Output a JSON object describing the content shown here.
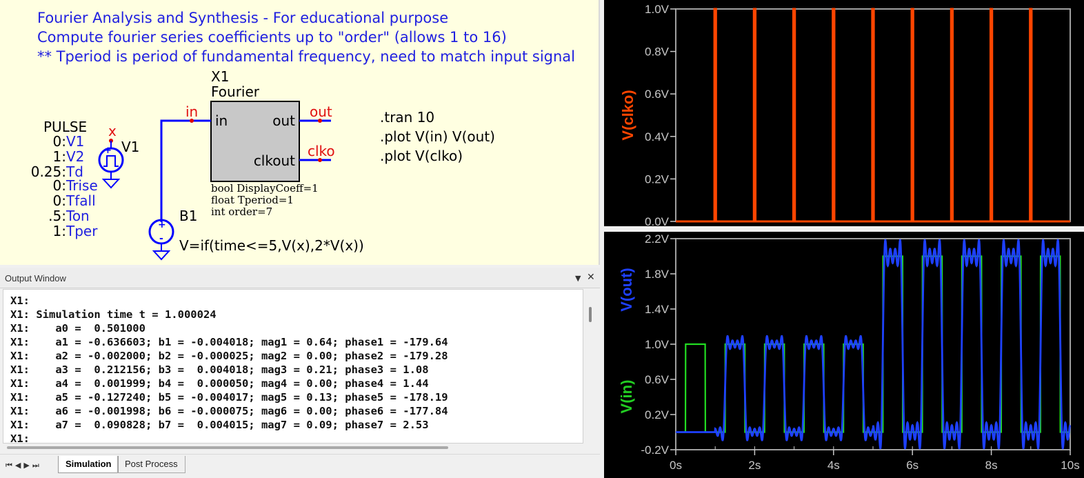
{
  "schematic": {
    "comments": [
      "Fourier Analysis and Synthesis - For educational purpose",
      "Compute fourier series coefficients up to \"order\" (allows 1 to 16)",
      "** Tperiod is period of fundamental frequency, need to match input signal"
    ],
    "x1": {
      "name": "X1",
      "type": "Fourier",
      "pin_in": "in",
      "pin_out": "out",
      "pin_clkout": "clkout",
      "params": [
        "bool DisplayCoeff=1",
        "float Tperiod=1",
        "int order=7"
      ]
    },
    "nets": {
      "in": "in",
      "out": "out",
      "clko": "clko",
      "x": "x"
    },
    "v1": {
      "name": "V1",
      "func": "PULSE",
      "params": [
        {
          "v": "0:",
          "k": "V1"
        },
        {
          "v": "1:",
          "k": "V2"
        },
        {
          "v": "0.25:",
          "k": "Td"
        },
        {
          "v": "0:",
          "k": "Trise"
        },
        {
          "v": "0:",
          "k": "Tfall"
        },
        {
          "v": ".5:",
          "k": "Ton"
        },
        {
          "v": "1:",
          "k": "Tper"
        }
      ]
    },
    "b1": {
      "name": "B1",
      "expr": "V=if(time<=5,V(x),2*V(x))"
    },
    "directives": [
      ".tran 10",
      ".plot V(in) V(out)",
      ".plot V(clko)"
    ]
  },
  "output_window": {
    "title": "Output Window",
    "lines": [
      "X1:",
      "X1: Simulation time t = 1.000024",
      "X1:    a0 =  0.501000",
      "X1:    a1 = -0.636603; b1 = -0.004018; mag1 = 0.64; phase1 = -179.64",
      "X1:    a2 = -0.002000; b2 = -0.000025; mag2 = 0.00; phase2 = -179.28",
      "X1:    a3 =  0.212156; b3 =  0.004018; mag3 = 0.21; phase3 = 1.08",
      "X1:    a4 =  0.001999; b4 =  0.000050; mag4 = 0.00; phase4 = 1.44",
      "X1:    a5 = -0.127240; b5 = -0.004017; mag5 = 0.13; phase5 = -178.19",
      "X1:    a6 = -0.001998; b6 = -0.000075; mag6 = 0.00; phase6 = -177.84",
      "X1:    a7 =  0.090828; b7 =  0.004015; mag7 = 0.09; phase7 = 2.53",
      "X1:"
    ],
    "tabs": [
      "Simulation",
      "Post Process"
    ],
    "active_tab": "Simulation"
  },
  "chart_data": [
    {
      "type": "line",
      "ylabel": "V(clko)",
      "ylim": [
        0,
        1.0
      ],
      "yticks": [
        "0.0V",
        "0.2V",
        "0.4V",
        "0.6V",
        "0.8V",
        "1.0V"
      ],
      "xlim": [
        0,
        10
      ],
      "series": [
        {
          "name": "V(clko)",
          "color": "#ff4500",
          "pulse_times": [
            1,
            2,
            3,
            4,
            5,
            6,
            7,
            8,
            9
          ],
          "low": 0,
          "high": 1
        }
      ]
    },
    {
      "type": "line",
      "ylabels": [
        {
          "text": "V(out)",
          "color": "#1e40ff"
        },
        {
          "text": "V(in)",
          "color": "#22cc22"
        }
      ],
      "ylim": [
        -0.2,
        2.2
      ],
      "yticks": [
        "-0.2V",
        "0.2V",
        "0.6V",
        "1.0V",
        "1.4V",
        "1.8V",
        "2.2V"
      ],
      "xlim": [
        0,
        10
      ],
      "xticks": [
        "0s",
        "2s",
        "4s",
        "6s",
        "8s",
        "10s"
      ],
      "series": [
        {
          "name": "V(in)",
          "color": "#22dd22",
          "td": 0.25,
          "ton": 0.5,
          "tper": 1,
          "gain_after": 2,
          "switch_time": 5
        },
        {
          "name": "V(out)",
          "color": "#1e40ff",
          "start": 1,
          "harmonics_order": 7,
          "a0": 0.501
        }
      ]
    }
  ]
}
